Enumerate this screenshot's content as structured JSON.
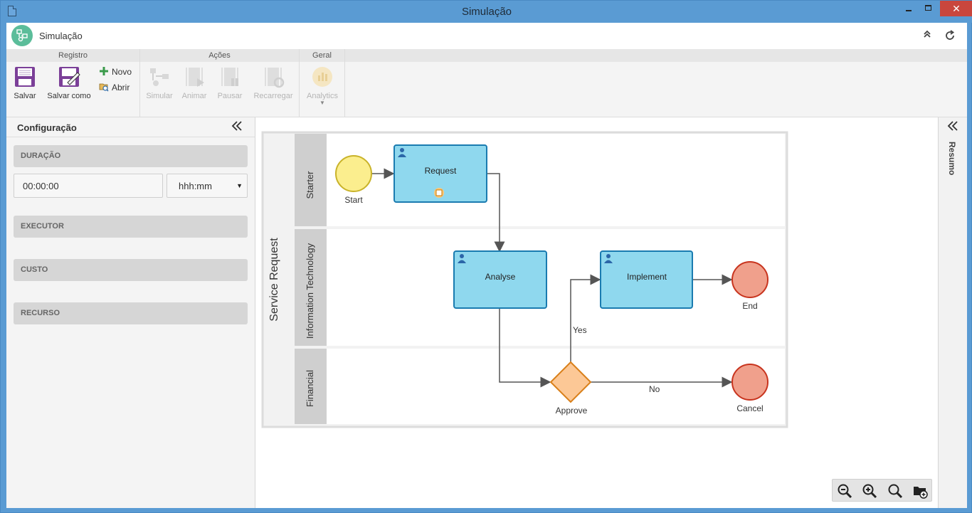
{
  "window": {
    "title": "Simulação"
  },
  "app": {
    "title": "Simulação"
  },
  "ribbon": {
    "groups": [
      {
        "title": "Registro"
      },
      {
        "title": "Ações"
      },
      {
        "title": "Geral"
      }
    ],
    "buttons": {
      "salvar": "Salvar",
      "salvar_como": "Salvar como",
      "novo": "Novo",
      "abrir": "Abrir",
      "simular": "Simular",
      "animar": "Animar",
      "pausar": "Pausar",
      "recarregar": "Recarregar",
      "analytics": "Analytics"
    }
  },
  "left_panel": {
    "title": "Configuração",
    "sections": [
      "DURAÇÃO",
      "EXECUTOR",
      "CUSTO",
      "RECURSO"
    ],
    "duration": {
      "value": "00:00:00",
      "unit": "hhh:mm"
    }
  },
  "right_panel": {
    "label": "Resumo"
  },
  "diagram": {
    "pool": "Service Request",
    "lanes": [
      "Starter",
      "Information Technology",
      "Financial"
    ],
    "nodes": {
      "start": "Start",
      "request": "Request",
      "analyse": "Analyse",
      "implement": "Implement",
      "end": "End",
      "approve": "Approve",
      "cancel": "Cancel"
    },
    "edges": {
      "yes": "Yes",
      "no": "No"
    }
  },
  "colors": {
    "task_fill": "#8fd8ee",
    "task_stroke": "#1a7bb0",
    "start_fill": "#fbee8e",
    "end_fill": "#f0a08c",
    "gateway_fill": "#fcc896"
  }
}
